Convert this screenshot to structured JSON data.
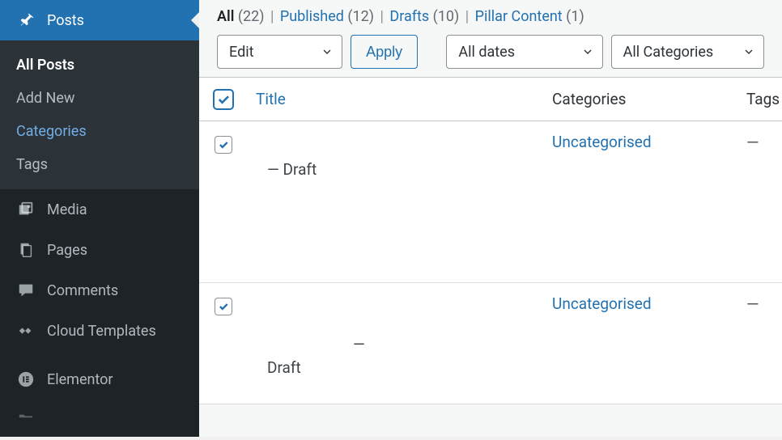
{
  "sidebar": {
    "posts": {
      "label": "Posts"
    },
    "submenu": [
      {
        "label": "All Posts",
        "current": true
      },
      {
        "label": "Add New"
      },
      {
        "label": "Categories",
        "active_link": true
      },
      {
        "label": "Tags"
      }
    ],
    "items": [
      {
        "label": "Media"
      },
      {
        "label": "Pages"
      },
      {
        "label": "Comments"
      },
      {
        "label": "Cloud Templates"
      },
      {
        "label": "Elementor"
      }
    ]
  },
  "filters": {
    "all": {
      "label": "All",
      "count": "(22)"
    },
    "published": {
      "label": "Published",
      "count": "(12)"
    },
    "drafts": {
      "label": "Drafts",
      "count": "(10)"
    },
    "pillar": {
      "label": "Pillar Content",
      "count": "(1)"
    }
  },
  "actions": {
    "bulk": "Edit",
    "apply": "Apply",
    "dates": "All dates",
    "categories": "All Categories"
  },
  "table": {
    "headers": {
      "title": "Title",
      "categories": "Categories",
      "tags": "Tags"
    },
    "rows": [
      {
        "status": "— Draft",
        "category": "Uncategorised",
        "tags": "—"
      },
      {
        "status_prefix": "—",
        "status_word": "Draft",
        "category": "Uncategorised",
        "tags": "—"
      }
    ]
  }
}
